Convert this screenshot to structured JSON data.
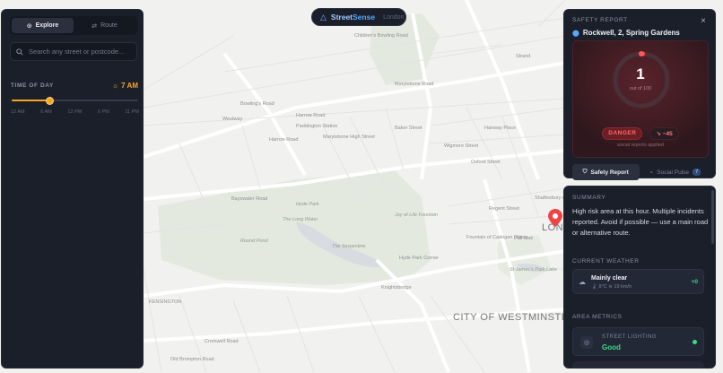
{
  "brand": {
    "name_a": "Street",
    "name_b": "Sense",
    "city": "London"
  },
  "left_panel": {
    "tabs": [
      {
        "label": "Explore",
        "icon": "compass-icon",
        "active": true
      },
      {
        "label": "Route",
        "icon": "route-icon",
        "active": false
      }
    ],
    "search_placeholder": "Search any street or postcode...",
    "time_of_day": {
      "label": "TIME OF DAY",
      "value": "7 AM",
      "fraction": 0.3
    },
    "ticks": [
      "12 AM",
      "6 AM",
      "12 PM",
      "6 PM",
      "11 PM"
    ]
  },
  "safety_report": {
    "header": "SAFETY REPORT",
    "close": "×",
    "address": "Rockwell, 2, Spring Gardens",
    "score": "1",
    "score_sub": "out of 100",
    "score_fraction": 0.01,
    "level": "DANGER",
    "delta": "−45",
    "delta_icon": "trend-down-icon",
    "social_note": "social reports applied",
    "tabs": [
      {
        "label": "Safety Report",
        "icon": "shield-icon",
        "active": true
      },
      {
        "label": "Social Pulse",
        "icon": "pulse-icon",
        "count": "7",
        "active": false
      }
    ]
  },
  "details": {
    "summary_title": "SUMMARY",
    "summary": "High risk area at this hour. Multiple incidents reported. Avoid if possible — use a main road or alternative route.",
    "weather_title": "CURRENT WEATHER",
    "weather": {
      "condition": "Mainly clear",
      "temp": "8°C",
      "wind": "19 km/h",
      "delta": "+0"
    },
    "metrics_title": "AREA METRICS",
    "metric": {
      "label": "STREET LIGHTING",
      "value": "Good",
      "icon": "bulb-icon"
    }
  },
  "map_labels": [
    "Bowling's Road",
    "Marylebone Road",
    "Paddington Station",
    "Children's Bowling Road",
    "Westway",
    "Harrow Road",
    "Marylebone High Street",
    "Bayswater Road",
    "The Long Water",
    "The Serpentine",
    "Round Pond",
    "Joy of Life Fountain",
    "Hyde Park Corner",
    "Oxford Street",
    "Knightsbridge",
    "KENSINGTON",
    "CITY OF WESTMINSTER",
    "LONDON",
    "Cromwell Road",
    "Shaftesbury Avenue",
    "Pall Mall",
    "St James's Park Lake",
    "Fountain of Cadogan Otters",
    "Harrow Road",
    "Old Brompton Road",
    "Wigmore Street",
    "Hanway Place",
    "Baker Street",
    "Hyde Park",
    "Regent Street",
    "Strand"
  ],
  "colors": {
    "accent": "#f6a623",
    "danger": "#ff5a5a",
    "safe": "#3ddc84",
    "brand": "#5aa7ff",
    "panel": "#1b1f2a"
  }
}
